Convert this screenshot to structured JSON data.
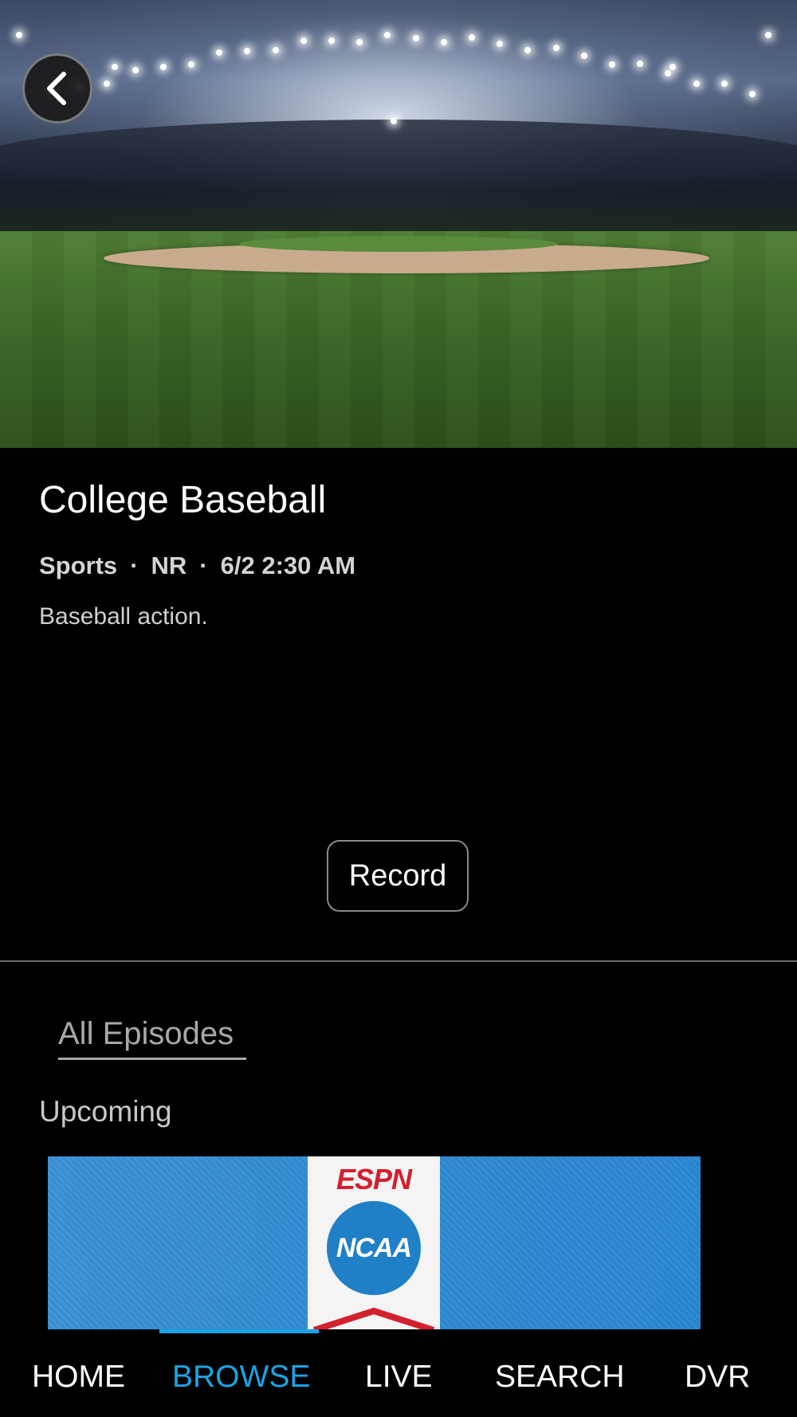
{
  "program": {
    "title": "College Baseball",
    "genre": "Sports",
    "rating": "NR",
    "airtime": "6/2 2:30 AM",
    "separator": "·",
    "description": "Baseball action."
  },
  "actions": {
    "record_label": "Record"
  },
  "episodes": {
    "tab_label": "All Episodes",
    "section_label": "Upcoming",
    "thumbnail_logos": [
      "ESPN",
      "NCAA"
    ]
  },
  "nav": {
    "items": [
      "HOME",
      "BROWSE",
      "LIVE",
      "SEARCH",
      "DVR"
    ],
    "active": "BROWSE"
  },
  "colors": {
    "accent": "#1aa3e6",
    "espn_red": "#d3202f",
    "ncaa_blue": "#1f7fc7"
  }
}
